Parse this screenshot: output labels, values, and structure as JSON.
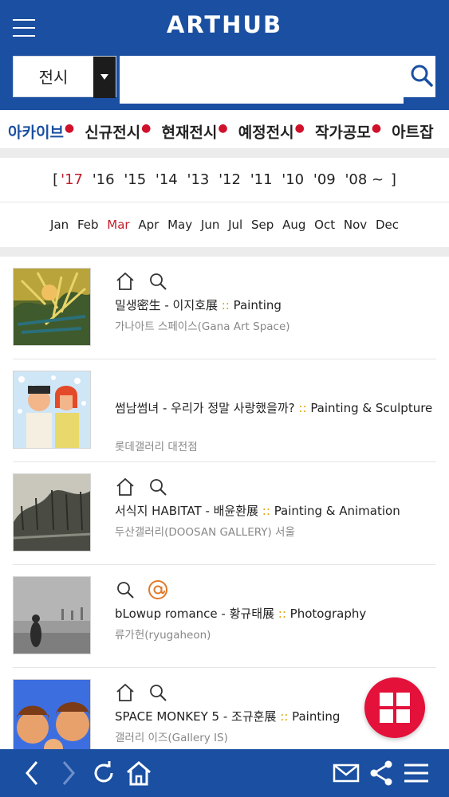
{
  "app": {
    "brand": "ARTHUB"
  },
  "search": {
    "category": "전시",
    "placeholder": ""
  },
  "categories": [
    {
      "label": "아카이브"
    },
    {
      "label": "신규전시"
    },
    {
      "label": "현재전시"
    },
    {
      "label": "예정전시"
    },
    {
      "label": "작가공모"
    },
    {
      "label": "아트잡"
    }
  ],
  "years": {
    "open": "[",
    "close": "]",
    "items": [
      "'17",
      "'16",
      "'15",
      "'14",
      "'13",
      "'12",
      "'11",
      "'10",
      "'09",
      "'08 ~"
    ],
    "active": "'17"
  },
  "months": {
    "items": [
      "Jan",
      "Feb",
      "Mar",
      "Apr",
      "May",
      "Jun",
      "Jul",
      "Sep",
      "Aug",
      "Oct",
      "Nov",
      "Dec"
    ],
    "active": "Mar"
  },
  "exhibitions": [
    {
      "title": "밀생密生 - 이지호展",
      "sep": " :: ",
      "genre": "Painting",
      "venue": "가나아트 스페이스(Gana Art Space)",
      "icons": [
        "home-icon",
        "search-icon"
      ]
    },
    {
      "title": "썸남썸녀 - 우리가 정말 사랑했을까?",
      "sep": " :: ",
      "genre": "Painting & Sculpture",
      "venue": "롯데갤러리 대전점",
      "icons": []
    },
    {
      "title": "서식지 HABITAT - 배윤환展",
      "sep": " :: ",
      "genre": "Painting & Animation",
      "venue": "두산갤러리(DOOSAN GALLERY) 서울",
      "icons": [
        "home-icon",
        "search-icon"
      ]
    },
    {
      "title": "bLowup romance - 황규태展",
      "sep": " :: ",
      "genre": "Photography",
      "venue": "류가헌(ryugaheon)",
      "icons": [
        "search-icon",
        "at-icon"
      ]
    },
    {
      "title": "SPACE MONKEY 5 - 조규훈展",
      "sep": " :: ",
      "genre": "Painting",
      "venue": "갤러리 이즈(Gallery IS)",
      "icons": [
        "home-icon",
        "search-icon"
      ]
    }
  ],
  "colors": {
    "primary": "#1a4fa1",
    "accent": "#c21d2b",
    "fab": "#e4113a"
  },
  "toolbar": {
    "icons": [
      "back-icon",
      "forward-icon",
      "refresh-icon",
      "home-icon",
      "mail-icon",
      "share-icon",
      "menu-icon"
    ]
  }
}
